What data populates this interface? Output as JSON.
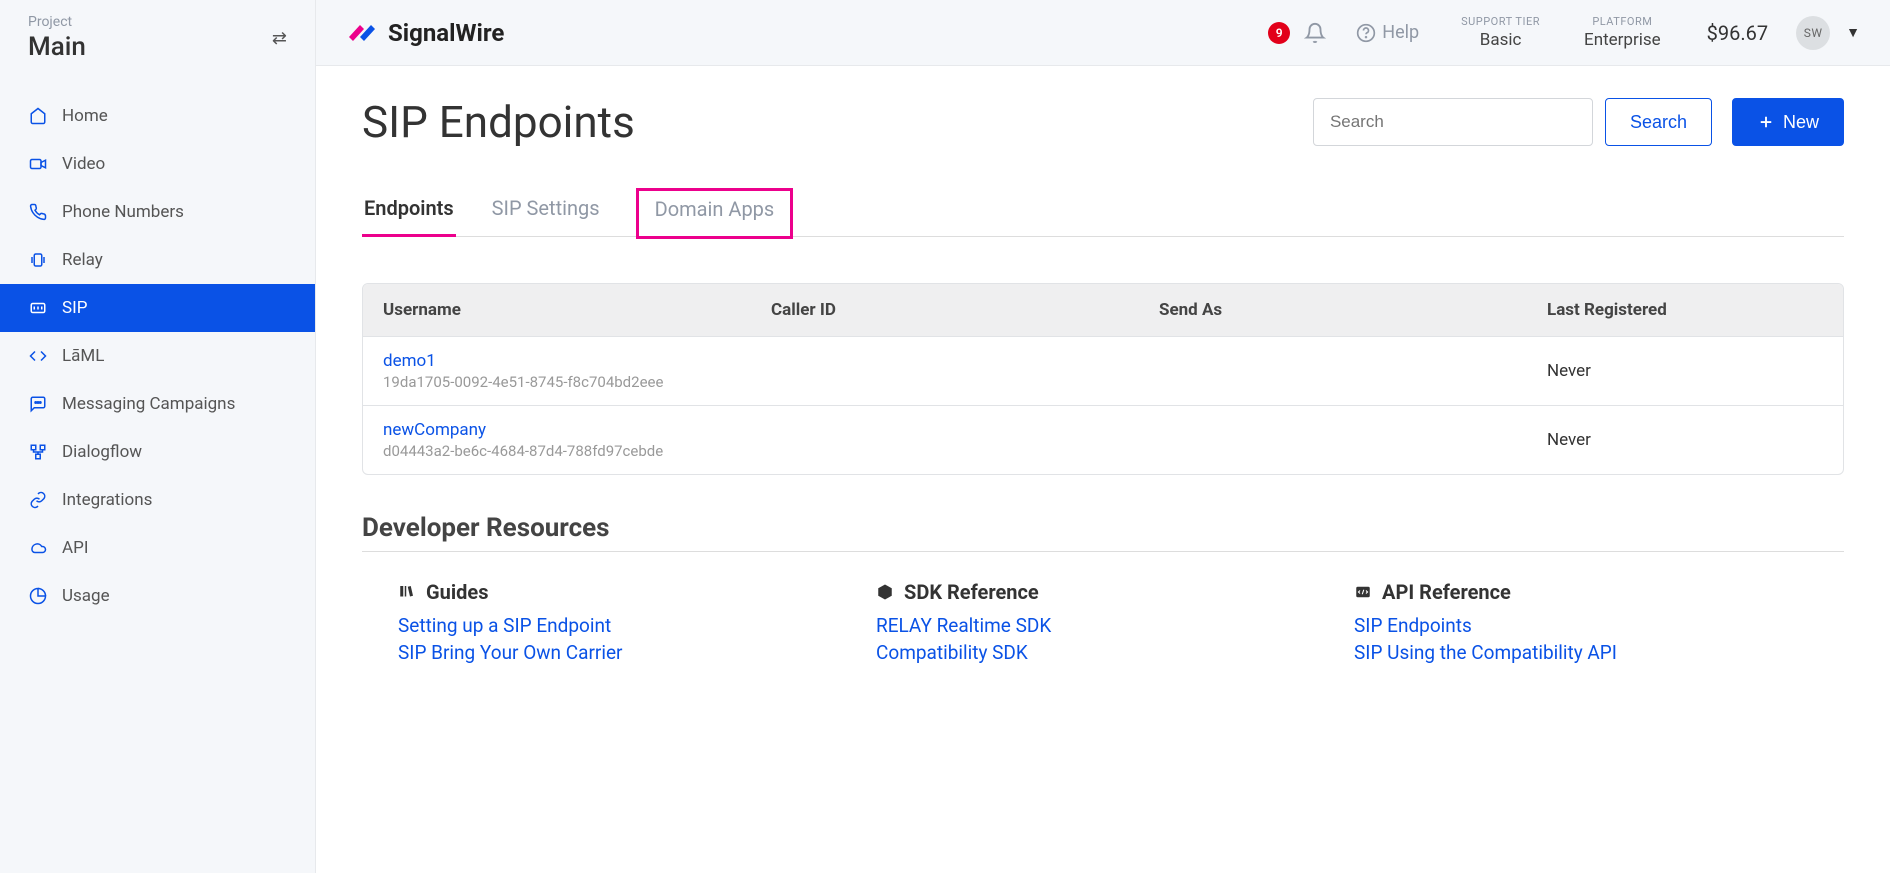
{
  "sidebar": {
    "project_label": "Project",
    "project_name": "Main",
    "items": [
      {
        "label": "Home",
        "icon": "home"
      },
      {
        "label": "Video",
        "icon": "video"
      },
      {
        "label": "Phone Numbers",
        "icon": "phone"
      },
      {
        "label": "Relay",
        "icon": "relay"
      },
      {
        "label": "SIP",
        "icon": "sip",
        "active": true
      },
      {
        "label": "LāML",
        "icon": "code"
      },
      {
        "label": "Messaging Campaigns",
        "icon": "message"
      },
      {
        "label": "Dialogflow",
        "icon": "flow"
      },
      {
        "label": "Integrations",
        "icon": "link"
      },
      {
        "label": "API",
        "icon": "cloud"
      },
      {
        "label": "Usage",
        "icon": "chart"
      }
    ]
  },
  "header": {
    "brand": "SignalWire",
    "notif_count": "9",
    "help": "Help",
    "support_tier_label": "SUPPORT TIER",
    "support_tier_value": "Basic",
    "platform_label": "PLATFORM",
    "platform_value": "Enterprise",
    "balance": "$96.67",
    "avatar": "SW"
  },
  "page": {
    "title": "SIP Endpoints",
    "search_placeholder": "Search",
    "search_btn": "Search",
    "new_btn": "New"
  },
  "tabs": [
    {
      "label": "Endpoints",
      "active": true
    },
    {
      "label": "SIP Settings"
    },
    {
      "label": "Domain Apps",
      "highlighted": true
    }
  ],
  "table": {
    "columns": [
      "Username",
      "Caller ID",
      "Send As",
      "Last Registered"
    ],
    "rows": [
      {
        "username": "demo1",
        "uuid": "19da1705-0092-4e51-8745-f8c704bd2eee",
        "caller_id": "",
        "send_as": "",
        "last_registered": "Never"
      },
      {
        "username": "newCompany",
        "uuid": "d04443a2-be6c-4684-87d4-788fd97cebde",
        "caller_id": "",
        "send_as": "",
        "last_registered": "Never"
      }
    ]
  },
  "dev": {
    "title": "Developer Resources",
    "cols": [
      {
        "heading": "Guides",
        "icon": "book",
        "links": [
          "Setting up a SIP Endpoint",
          "SIP Bring Your Own Carrier"
        ]
      },
      {
        "heading": "SDK Reference",
        "icon": "pkg",
        "links": [
          "RELAY Realtime SDK",
          "Compatibility SDK"
        ]
      },
      {
        "heading": "API Reference",
        "icon": "api",
        "links": [
          "SIP Endpoints",
          "SIP Using the Compatibility API"
        ]
      }
    ]
  }
}
